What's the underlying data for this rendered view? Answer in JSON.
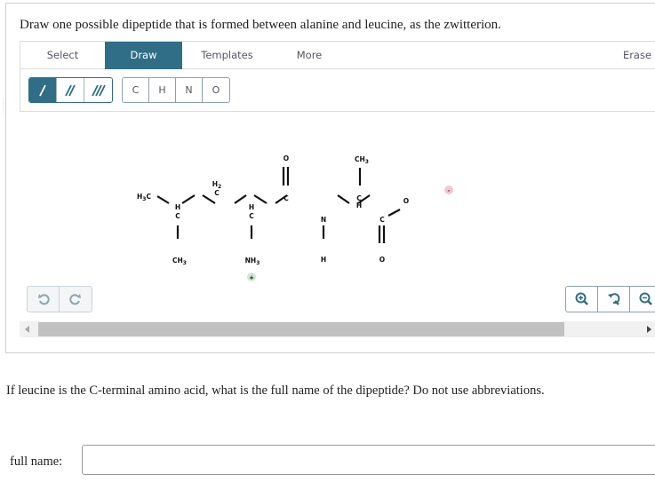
{
  "question1": {
    "prompt": "Draw one possible dipeptide that is formed between alanine and leucine, as the zwitterion."
  },
  "editor": {
    "tabs": [
      {
        "label": "Select",
        "active": false
      },
      {
        "label": "Draw",
        "active": true
      },
      {
        "label": "Templates",
        "active": false
      },
      {
        "label": "More",
        "active": false
      }
    ],
    "erase_label": "Erase",
    "bond_tools": [
      {
        "icon": "single-bond-icon",
        "active": true
      },
      {
        "icon": "double-bond-icon",
        "active": false
      },
      {
        "icon": "triple-bond-icon",
        "active": false
      }
    ],
    "atom_tools": [
      "C",
      "H",
      "N",
      "O"
    ],
    "molecule": {
      "atoms": {
        "h3c_left": "H3C",
        "ch_leu_h": "H",
        "ch_leu_c": "C",
        "ch3_leu": "CH3",
        "ch2_h": "H2",
        "ch2_c": "C",
        "alpha_leu_h": "H",
        "alpha_leu_c": "C",
        "nh3": "NH3",
        "carbonyl_o": "O",
        "carbonyl_c": "C",
        "amide_n": "N",
        "amide_h": "H",
        "ch3_ala": "CH3",
        "alpha_ala_c": "C",
        "alpha_ala_h": "H",
        "carboxyl_c": "C",
        "carboxyl_o_double": "O",
        "carboxylate_o": "O"
      },
      "charges": {
        "positive": "+",
        "negative": "-"
      },
      "colors": {
        "positive_badge": "#cfe8cf",
        "negative_badge": "#f2c9cf"
      }
    },
    "history_buttons": [
      "undo-icon",
      "redo-icon"
    ],
    "zoom_buttons": [
      "zoom-in-icon",
      "reset-zoom-icon",
      "zoom-out-icon"
    ],
    "accent_color": "#2f6e86"
  },
  "question2": {
    "prompt": "If leucine is the C-terminal amino acid, what is the full name of the dipeptide? Do not use abbreviations.",
    "field_label": "full name:",
    "field_value": ""
  }
}
